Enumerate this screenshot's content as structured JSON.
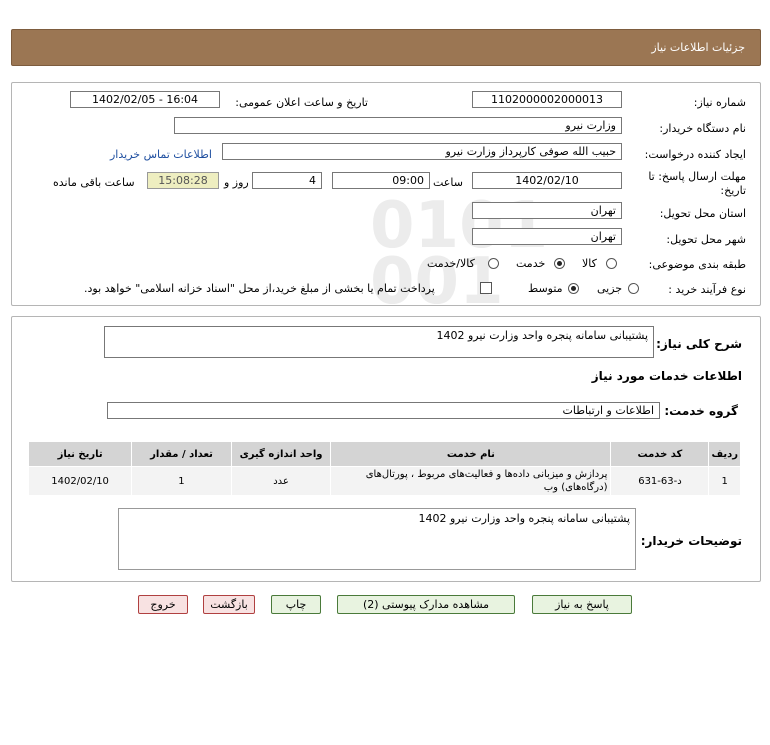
{
  "header": {
    "title": "جزئیات اطلاعات نیاز"
  },
  "form": {
    "need_number_label": "شماره نیاز:",
    "need_number": "1102000002000013",
    "announce_label": "تاریخ و ساعت اعلان عمومی:",
    "announce_value": "1402/02/05 - 16:04",
    "buyer_org_label": "نام دستگاه خریدار:",
    "buyer_org": "وزارت نیرو",
    "requester_label": "ایجاد کننده درخواست:",
    "requester": "حبیب الله صوفی کارپرداز وزارت نیرو",
    "contact_link": "اطلاعات تماس خریدار",
    "deadline_label_1": "مهلت ارسال پاسخ: تا",
    "deadline_label_2": "تاریخ:",
    "deadline_date": "1402/02/10",
    "time_label": "ساعت",
    "deadline_time": "09:00",
    "days_value": "4",
    "days_label": "روز و",
    "remaining_time": "15:08:28",
    "remaining_label": "ساعت باقی مانده",
    "province_label": "استان محل تحویل:",
    "province": "تهران",
    "city_label": "شهر محل تحویل:",
    "city": "تهران",
    "category_label": "طبقه بندی موضوعی:",
    "category_options": [
      "کالا",
      "خدمت",
      "کالا/خدمت"
    ],
    "category_selected": "خدمت",
    "process_label": "نوع فرآیند خرید :",
    "process_options": [
      "جزیی",
      "متوسط"
    ],
    "process_selected": "متوسط",
    "payment_note": "پرداخت تمام یا بخشی از مبلغ خرید،از محل \"اسناد خزانه اسلامی\" خواهد بود."
  },
  "summary": {
    "label": "شرح کلی نیاز:",
    "value": "پشتیبانی سامانه پنجره واحد وزارت نیرو 1402",
    "services_title": "اطلاعات خدمات مورد نیاز",
    "group_label": "گروه خدمت:",
    "group_value": "اطلاعات و ارتباطات"
  },
  "table": {
    "headers": [
      "ردیف",
      "کد خدمت",
      "نام خدمت",
      "واحد اندازه گیری",
      "تعداد / مقدار",
      "تاریخ نیاز"
    ],
    "rows": [
      [
        "1",
        "د-63-631",
        "پردازش و میزبانی داده‌ها و فعالیت‌های مربوط ، پورتال‌های (درگاه‌های) وب",
        "عدد",
        "1",
        "1402/02/10"
      ]
    ]
  },
  "buyer_notes": {
    "label": "توضیحات خریدار:",
    "value": "پشتیبانی سامانه پنجره واحد وزارت نیرو 1402"
  },
  "buttons": {
    "reply": "پاسخ به نیاز",
    "view_docs": "مشاهده مدارک پیوستی (2)",
    "print": "چاپ",
    "back": "بازگشت",
    "exit": "خروج"
  }
}
